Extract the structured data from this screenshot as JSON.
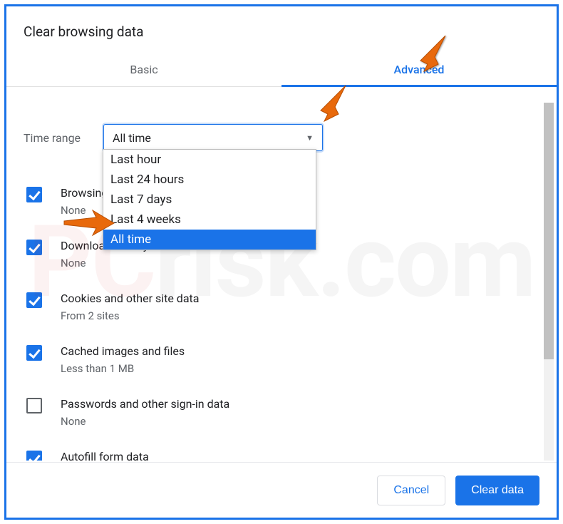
{
  "dialog": {
    "title": "Clear browsing data"
  },
  "tabs": {
    "basic": "Basic",
    "advanced": "Advanced"
  },
  "time": {
    "label": "Time range",
    "value": "All time",
    "options": [
      "Last hour",
      "Last 24 hours",
      "Last 7 days",
      "Last 4 weeks",
      "All time"
    ]
  },
  "items": [
    {
      "title": "Browsing history",
      "sub": "None",
      "checked": true
    },
    {
      "title": "Download history",
      "sub": "None",
      "checked": true
    },
    {
      "title": "Cookies and other site data",
      "sub": "From 2 sites",
      "checked": true
    },
    {
      "title": "Cached images and files",
      "sub": "Less than 1 MB",
      "checked": true
    },
    {
      "title": "Passwords and other sign-in data",
      "sub": "None",
      "checked": false
    },
    {
      "title": "Autofill form data",
      "sub": "",
      "checked": true
    }
  ],
  "footer": {
    "cancel": "Cancel",
    "clear": "Clear data"
  },
  "watermark": {
    "prefix": "PC",
    "suffix": "risk.com"
  }
}
